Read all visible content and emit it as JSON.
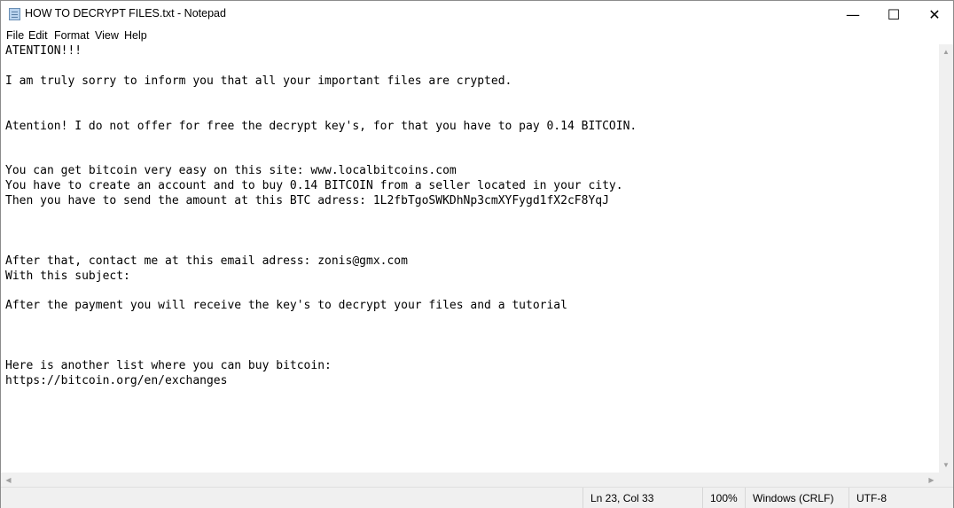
{
  "window": {
    "title": "HOW TO DECRYPT FILES.txt - Notepad",
    "app_icon": "notepad-icon",
    "controls": {
      "minimize": "—",
      "maximize": "☐",
      "close": "✕"
    }
  },
  "menu": {
    "items": [
      {
        "label": "File"
      },
      {
        "label": "Edit"
      },
      {
        "label": "Format"
      },
      {
        "label": "View"
      },
      {
        "label": "Help"
      }
    ]
  },
  "editor": {
    "content": "ATENTION!!!\n\nI am truly sorry to inform you that all your important files are crypted.\n\n\nAtention! I do not offer for free the decrypt key's, for that you have to pay 0.14 BITCOIN.\n\n\nYou can get bitcoin very easy on this site: www.localbitcoins.com\nYou have to create an account and to buy 0.14 BITCOIN from a seller located in your city.\nThen you have to send the amount at this BTC adress: 1L2fbTgoSWKDhNp3cmXYFygd1fX2cF8YqJ\n\n\n\nAfter that, contact me at this email adress: zonis@gmx.com\nWith this subject:\n\nAfter the payment you will receive the key's to decrypt your files and a tutorial\n\n\n\nHere is another list where you can buy bitcoin:\nhttps://bitcoin.org/en/exchanges"
  },
  "statusbar": {
    "position": "Ln 23, Col 33",
    "zoom": "100%",
    "line_ending": "Windows (CRLF)",
    "encoding": "UTF-8"
  }
}
